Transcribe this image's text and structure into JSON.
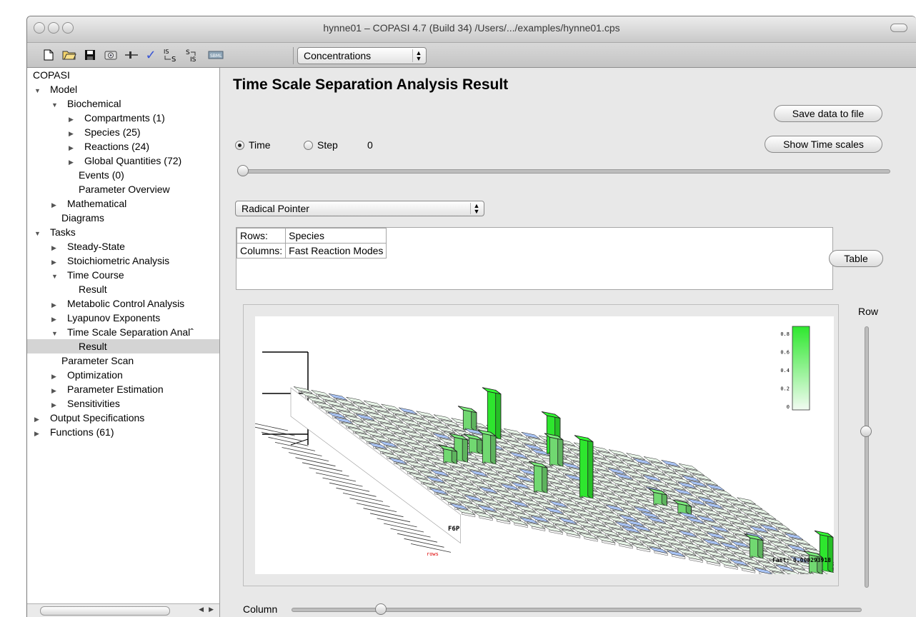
{
  "window": {
    "title": "hynne01 – COPASI 4.7 (Build 34) /Users/.../examples/hynne01.cps"
  },
  "toolbar": {
    "icons": [
      "new-file-icon",
      "open-folder-icon",
      "save-disk-icon",
      "camera-icon",
      "slider-icon",
      "check-icon",
      "is-to-s-icon",
      "s-to-is-icon",
      "sbml-icon"
    ],
    "check_label": "✓",
    "is_s_label": "IS→S",
    "s_is_label": "S→IS",
    "quantity_combo": "Concentrations"
  },
  "tree": {
    "root": "COPASI",
    "items": [
      {
        "label": "Model",
        "depth": 0,
        "expanded": true
      },
      {
        "label": "Biochemical",
        "depth": 1,
        "expanded": true
      },
      {
        "label": "Compartments (1)",
        "depth": 2,
        "expanded": false
      },
      {
        "label": "Species (25)",
        "depth": 2,
        "expanded": false
      },
      {
        "label": "Reactions (24)",
        "depth": 2,
        "expanded": false
      },
      {
        "label": "Global Quantities (72)",
        "depth": 2,
        "expanded": false
      },
      {
        "label": "Events (0)",
        "depth": 2,
        "leaf": true
      },
      {
        "label": "Parameter Overview",
        "depth": 2,
        "leaf": true
      },
      {
        "label": "Mathematical",
        "depth": 1,
        "expanded": false
      },
      {
        "label": "Diagrams",
        "depth": 1,
        "leaf": true
      },
      {
        "label": "Tasks",
        "depth": 0,
        "expanded": true
      },
      {
        "label": "Steady-State",
        "depth": 1,
        "expanded": false
      },
      {
        "label": "Stoichiometric Analysis",
        "depth": 1,
        "expanded": false
      },
      {
        "label": "Time Course",
        "depth": 1,
        "expanded": true
      },
      {
        "label": "Result",
        "depth": 2,
        "leaf": true
      },
      {
        "label": "Metabolic Control Analysis",
        "depth": 1,
        "expanded": false
      },
      {
        "label": "Lyapunov Exponents",
        "depth": 1,
        "expanded": false
      },
      {
        "label": "Time Scale Separation Analˆ",
        "depth": 1,
        "expanded": true
      },
      {
        "label": "Result",
        "depth": 2,
        "leaf": true,
        "selected": true
      },
      {
        "label": "Parameter Scan",
        "depth": 1,
        "leaf": true
      },
      {
        "label": "Optimization",
        "depth": 1,
        "expanded": false
      },
      {
        "label": "Parameter Estimation",
        "depth": 1,
        "expanded": false
      },
      {
        "label": "Sensitivities",
        "depth": 1,
        "expanded": false
      },
      {
        "label": "Output Specifications",
        "depth": 0,
        "expanded": false
      },
      {
        "label": "Functions (61)",
        "depth": 0,
        "expanded": false
      }
    ]
  },
  "result": {
    "heading": "Time Scale Separation Analysis Result",
    "save_button": "Save data to file",
    "show_timescales_button": "Show Time scales",
    "table_button": "Table",
    "radio_time": "Time",
    "radio_step": "Step",
    "step_value": "0",
    "time_selected": true,
    "view_combo": "Radical Pointer",
    "rows_header": "Rows:",
    "rows_value": "Species",
    "columns_header": "Columns:",
    "columns_value": "Fast Reaction Modes",
    "row_slider_label": "Row",
    "column_slider_label": "Column",
    "time_slider_value": 0,
    "row_slider_value": 0.4,
    "column_slider_value": 0.15
  },
  "plot3d": {
    "legend_ticks": [
      "0.8",
      "0.6",
      "0.4",
      "0.2",
      "0"
    ],
    "row_label": "F6P",
    "axis_label": "rows",
    "fast_text": "Fast: 0.000293918",
    "colors": {
      "high": "#33ff33",
      "low": "#e8f5e8",
      "negative": "#a9c4f5",
      "edge": "#222222"
    }
  }
}
